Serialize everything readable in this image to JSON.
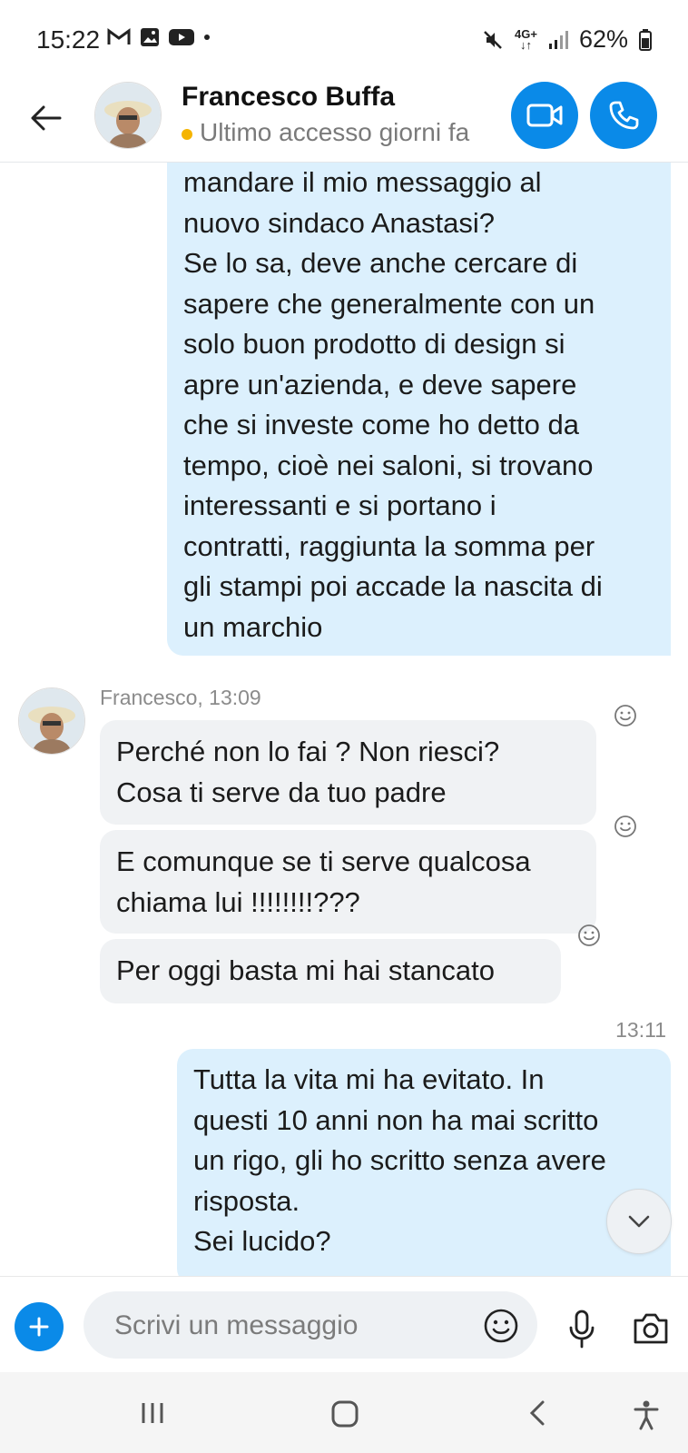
{
  "status_bar": {
    "time": "15:22",
    "network": "4G+",
    "battery": "62%",
    "icons": [
      "gmail-icon",
      "gallery-icon",
      "youtube-icon",
      "dot-icon",
      "mute-icon",
      "signal-icon",
      "battery-icon"
    ]
  },
  "header": {
    "contact_name": "Francesco Buffa",
    "presence": "Ultimo accesso giorni fa",
    "presence_color": "#f5b400",
    "accent_color": "#0a8ae8"
  },
  "messages": {
    "first_outgoing": {
      "lines": [
        "mandare il mio messaggio al",
        "nuovo sindaco Anastasi?",
        "Se lo sa, deve anche cercare di",
        "sapere che generalmente con un",
        "solo buon prodotto di design si",
        "apre un'azienda, e deve sapere",
        "che si investe come ho detto da",
        "tempo,  cioè nei saloni, si trovano",
        "interessanti e si portano i",
        "contratti,  raggiunta la somma per",
        "gli stampi poi accade la nascita di",
        "un marchio"
      ]
    },
    "incoming_sender": "Francesco, 13:09",
    "incoming": [
      {
        "lines": [
          "Perché non lo fai ? Non riesci?",
          "Cosa ti serve da tuo padre"
        ]
      },
      {
        "lines": [
          "E comunque se ti serve qualcosa",
          "chiama lui !!!!!!!!???"
        ]
      },
      {
        "lines": [
          "Per oggi basta mi hai stancato"
        ]
      }
    ],
    "outgoing_time": "13:11",
    "last_outgoing": {
      "lines": [
        "Tutta la vita mi ha evitato. In",
        "questi 10 anni non ha mai scritto",
        "un rigo, gli ho scritto senza avere",
        "risposta.",
        "Sei lucido?"
      ]
    }
  },
  "composer": {
    "placeholder": "Scrivi un messaggio"
  },
  "colors": {
    "outgoing_bubble": "#dcf0fd",
    "incoming_bubble": "#f0f2f4"
  }
}
